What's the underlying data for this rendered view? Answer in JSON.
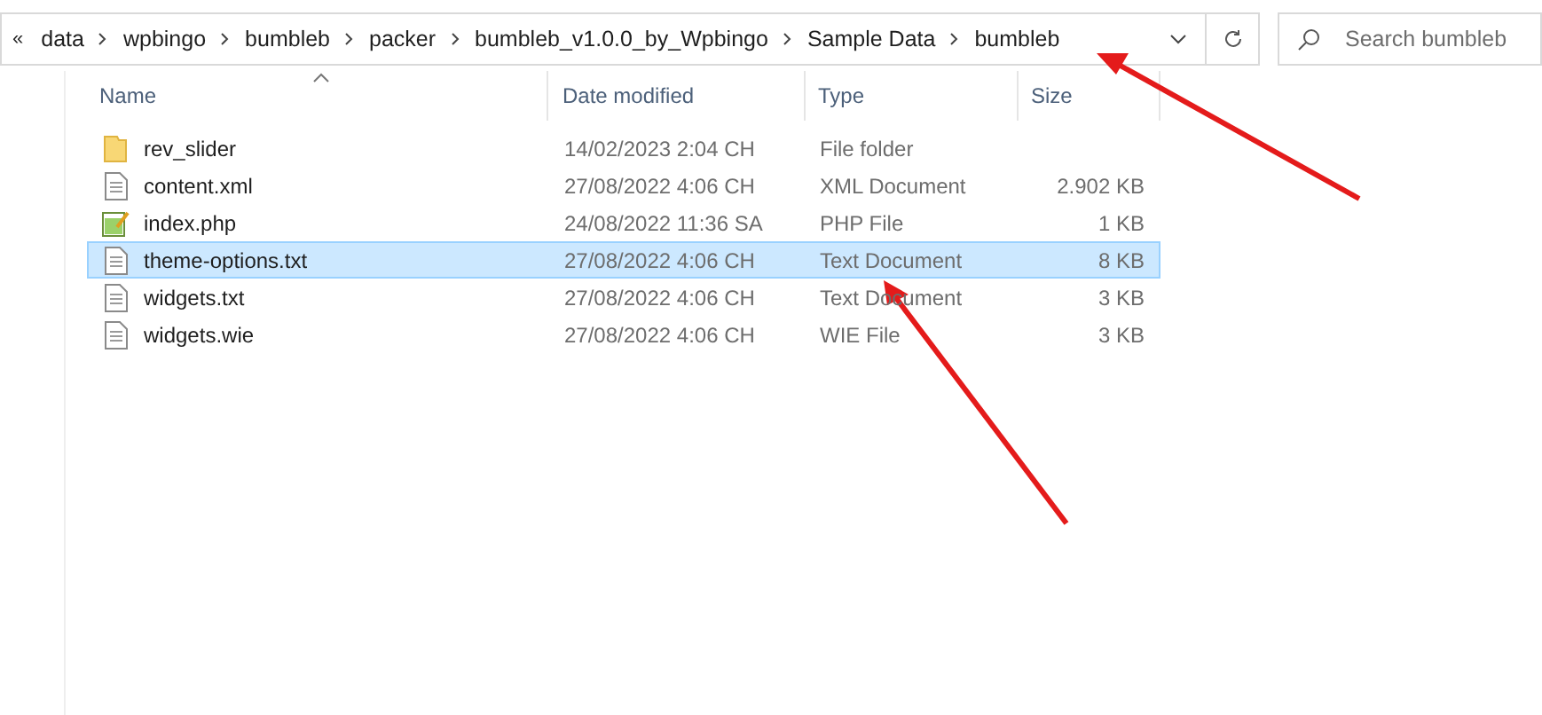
{
  "address_bar": {
    "overflow": "«",
    "path": [
      "data",
      "wpbingo",
      "bumbleb",
      "packer",
      "bumbleb_v1.0.0_by_Wpbingo",
      "Sample Data",
      "bumbleb"
    ]
  },
  "search": {
    "placeholder": "Search bumbleb"
  },
  "table": {
    "columns": [
      "Name",
      "Date modified",
      "Type",
      "Size"
    ],
    "rows": [
      {
        "kind": "folder",
        "name": "rev_slider",
        "date": "14/02/2023 2:04 CH",
        "type": "File folder",
        "size": "",
        "selected": false
      },
      {
        "kind": "file",
        "name": "content.xml",
        "date": "27/08/2022 4:06 CH",
        "type": "XML Document",
        "size": "2.902 KB",
        "selected": false
      },
      {
        "kind": "php",
        "name": "index.php",
        "date": "24/08/2022 11:36 SA",
        "type": "PHP File",
        "size": "1 KB",
        "selected": false
      },
      {
        "kind": "file",
        "name": "theme-options.txt",
        "date": "27/08/2022 4:06 CH",
        "type": "Text Document",
        "size": "8 KB",
        "selected": true
      },
      {
        "kind": "file",
        "name": "widgets.txt",
        "date": "27/08/2022 4:06 CH",
        "type": "Text Document",
        "size": "3 KB",
        "selected": false
      },
      {
        "kind": "file",
        "name": "widgets.wie",
        "date": "27/08/2022 4:06 CH",
        "type": "WIE File",
        "size": "3 KB",
        "selected": false
      }
    ]
  }
}
